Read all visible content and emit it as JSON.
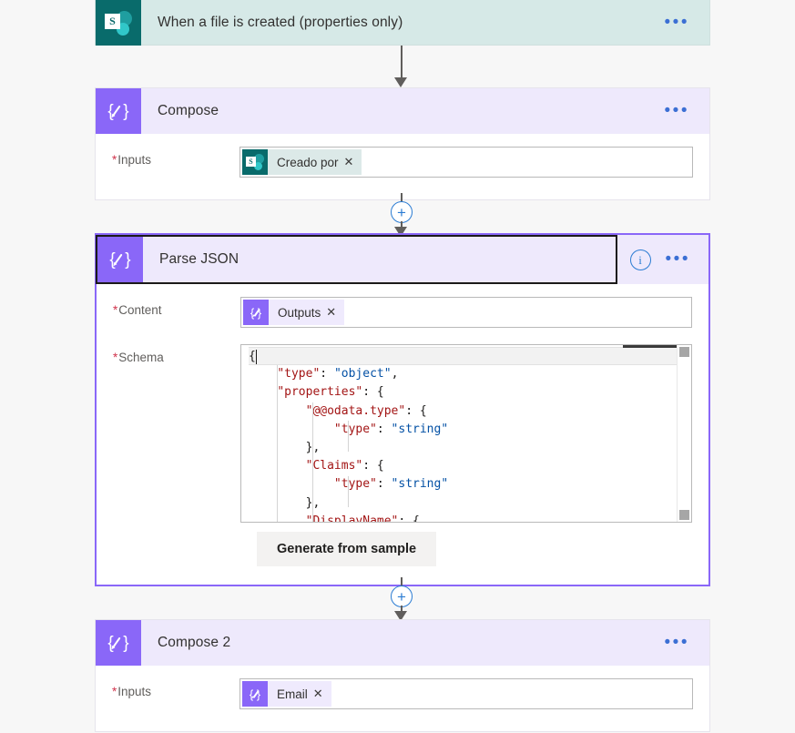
{
  "flow": {
    "trigger": {
      "title": "When a file is created (properties only)",
      "icon": "sharepoint-icon",
      "icon_letter": "S",
      "menu": "•••",
      "bg_color": "#d6e9e7",
      "icon_bg": "#096b6b"
    },
    "compose": {
      "title": "Compose",
      "icon": "data-operation-compose-icon",
      "menu": "•••",
      "field_label": "Inputs",
      "required_mark": "*",
      "token": {
        "label": "Creado por",
        "icon": "sharepoint-icon",
        "icon_letter": "S",
        "remove": "✕"
      }
    },
    "parse_json": {
      "title": "Parse JSON",
      "icon": "data-operation-compose-icon",
      "info": "i",
      "menu": "•••",
      "selected": true,
      "accent_color": "#8a67f8",
      "content_label": "Content",
      "schema_label": "Schema",
      "required_mark": "*",
      "token": {
        "label": "Outputs",
        "icon": "data-operation-compose-icon",
        "remove": "✕"
      },
      "generate_button": "Generate from sample",
      "schema_lines": [
        [
          {
            "t": "{",
            "c": "p"
          }
        ],
        [
          {
            "t": "    ",
            "c": "p"
          },
          {
            "t": "\"type\"",
            "c": "k"
          },
          {
            "t": ": ",
            "c": "p"
          },
          {
            "t": "\"object\"",
            "c": "s"
          },
          {
            "t": ",",
            "c": "p"
          }
        ],
        [
          {
            "t": "    ",
            "c": "p"
          },
          {
            "t": "\"properties\"",
            "c": "k"
          },
          {
            "t": ": {",
            "c": "p"
          }
        ],
        [
          {
            "t": "        ",
            "c": "p"
          },
          {
            "t": "\"@@odata.type\"",
            "c": "k"
          },
          {
            "t": ": {",
            "c": "p"
          }
        ],
        [
          {
            "t": "            ",
            "c": "p"
          },
          {
            "t": "\"type\"",
            "c": "k"
          },
          {
            "t": ": ",
            "c": "p"
          },
          {
            "t": "\"string\"",
            "c": "s"
          }
        ],
        [
          {
            "t": "        },",
            "c": "p"
          }
        ],
        [
          {
            "t": "        ",
            "c": "p"
          },
          {
            "t": "\"Claims\"",
            "c": "k"
          },
          {
            "t": ": {",
            "c": "p"
          }
        ],
        [
          {
            "t": "            ",
            "c": "p"
          },
          {
            "t": "\"type\"",
            "c": "k"
          },
          {
            "t": ": ",
            "c": "p"
          },
          {
            "t": "\"string\"",
            "c": "s"
          }
        ],
        [
          {
            "t": "        },",
            "c": "p"
          }
        ],
        [
          {
            "t": "        ",
            "c": "p"
          },
          {
            "t": "\"DisplayName\"",
            "c": "k"
          },
          {
            "t": ": {",
            "c": "p"
          }
        ]
      ]
    },
    "compose2": {
      "title": "Compose 2",
      "icon": "data-operation-compose-icon",
      "menu": "•••",
      "field_label": "Inputs",
      "required_mark": "*",
      "token": {
        "label": "Email",
        "icon": "data-operation-compose-icon",
        "remove": "✕"
      }
    },
    "connectors": {
      "add_step": "+"
    }
  }
}
